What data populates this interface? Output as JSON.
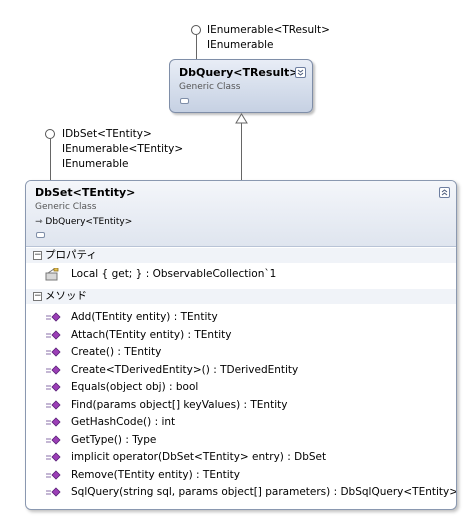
{
  "top_interface": {
    "lines": [
      "IEnumerable<TResult>",
      "IEnumerable"
    ]
  },
  "top_class": {
    "title": "DbQuery<TResult>",
    "subtitle": "Generic Class",
    "toggle": "⌄"
  },
  "main_interface": {
    "lines": [
      "IDbSet<TEntity>",
      "IEnumerable<TEntity>",
      "IEnumerable"
    ]
  },
  "main_class": {
    "title": "DbSet<TEntity>",
    "subtitle": "Generic Class",
    "base_ref": "DbQuery<TEntity>",
    "toggle": "⌃"
  },
  "sections": {
    "properties": {
      "label": "プロパティ",
      "items": [
        "Local { get; } : ObservableCollection`1"
      ]
    },
    "methods": {
      "label": "メソッド",
      "items": [
        "Add(TEntity entity) : TEntity",
        "Attach(TEntity entity) : TEntity",
        "Create() : TEntity",
        "Create<TDerivedEntity>() : TDerivedEntity",
        "Equals(object obj) : bool",
        "Find(params object[] keyValues) : TEntity",
        "GetHashCode() : int",
        "GetType() : Type",
        "implicit operator(DbSet<TEntity> entry) : DbSet",
        "Remove(TEntity entity) : TEntity",
        "SqlQuery(string sql, params object[] parameters) : DbSqlQuery<TEntity>"
      ]
    }
  },
  "colors": {
    "header_gradient_top": "#e8edf6",
    "header_gradient_bottom": "#c6d1e3",
    "border": "#8a98b0",
    "method_icon": "#9b3fb6"
  }
}
